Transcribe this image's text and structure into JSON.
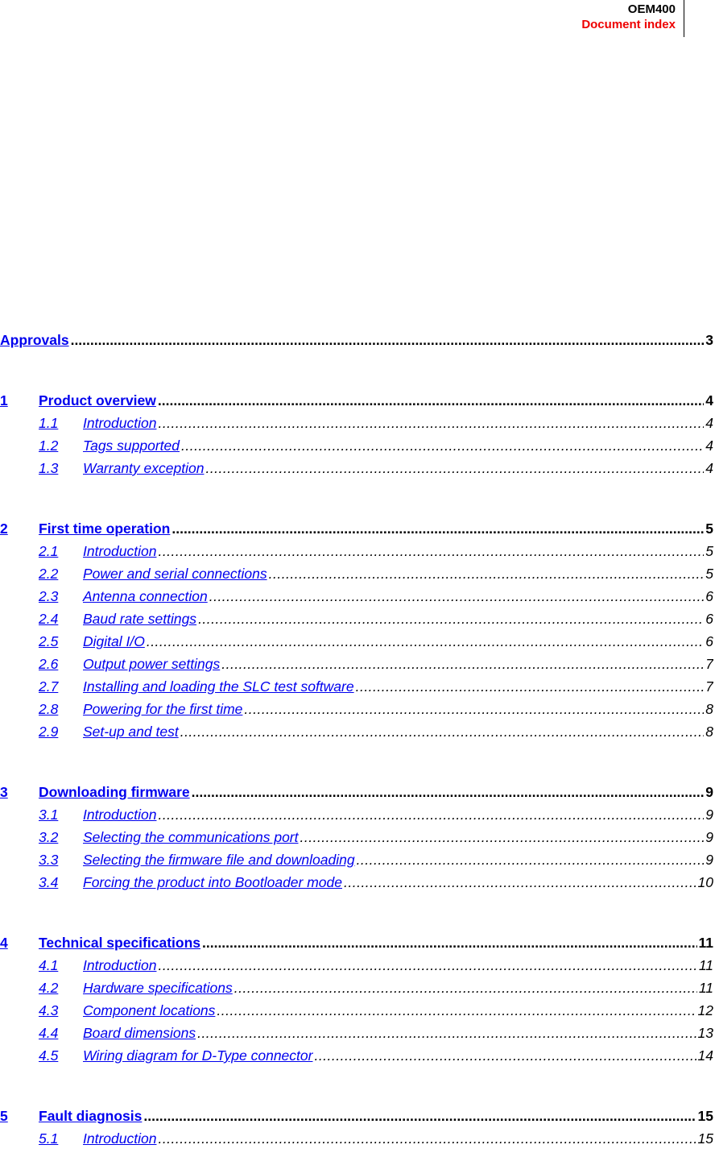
{
  "header": {
    "product": "OEM400",
    "section": "Document index"
  },
  "toc": {
    "approvals": {
      "title": "Approvals",
      "page": "3"
    },
    "chapters": [
      {
        "num": "1",
        "title": "Product overview",
        "page": "4",
        "items": [
          {
            "num": "1.1",
            "title": "Introduction",
            "page": "4"
          },
          {
            "num": "1.2",
            "title": "Tags supported",
            "page": "4"
          },
          {
            "num": "1.3",
            "title": "Warranty exception",
            "page": "4"
          }
        ]
      },
      {
        "num": "2",
        "title": "First time operation",
        "page": "5",
        "items": [
          {
            "num": "2.1",
            "title": "Introduction",
            "page": "5"
          },
          {
            "num": "2.2",
            "title": "Power and serial connections",
            "page": "5"
          },
          {
            "num": "2.3",
            "title": "Antenna connection",
            "page": "6"
          },
          {
            "num": "2.4",
            "title": "Baud rate settings",
            "page": "6"
          },
          {
            "num": "2.5",
            "title": "Digital I/O",
            "page": "6"
          },
          {
            "num": "2.6",
            "title": "Output power settings",
            "page": "7"
          },
          {
            "num": "2.7",
            "title": "Installing and loading the SLC test software",
            "page": "7"
          },
          {
            "num": "2.8",
            "title": "Powering for the first time",
            "page": "8"
          },
          {
            "num": "2.9",
            "title": "Set-up and test",
            "page": "8"
          }
        ]
      },
      {
        "num": "3",
        "title": "Downloading firmware",
        "page": "9",
        "items": [
          {
            "num": "3.1",
            "title": "Introduction",
            "page": "9"
          },
          {
            "num": "3.2",
            "title": "Selecting the communications port",
            "page": "9"
          },
          {
            "num": "3.3",
            "title": "Selecting the firmware file and downloading",
            "page": "9"
          },
          {
            "num": "3.4",
            "title": "Forcing the product into Bootloader mode",
            "page": "10"
          }
        ]
      },
      {
        "num": "4",
        "title": "Technical specifications",
        "page": "11",
        "items": [
          {
            "num": "4.1",
            "title": "Introduction",
            "page": "11"
          },
          {
            "num": "4.2",
            "title": "Hardware specifications",
            "page": "11"
          },
          {
            "num": "4.3",
            "title": "Component locations",
            "page": "12"
          },
          {
            "num": "4.4",
            "title": "Board dimensions",
            "page": "13"
          },
          {
            "num": "4.5",
            "title": "Wiring diagram for D-Type connector",
            "page": "14"
          }
        ]
      },
      {
        "num": "5",
        "title": "Fault diagnosis",
        "page": "15",
        "items": [
          {
            "num": "5.1",
            "title": "Introduction",
            "page": "15"
          }
        ]
      }
    ]
  }
}
